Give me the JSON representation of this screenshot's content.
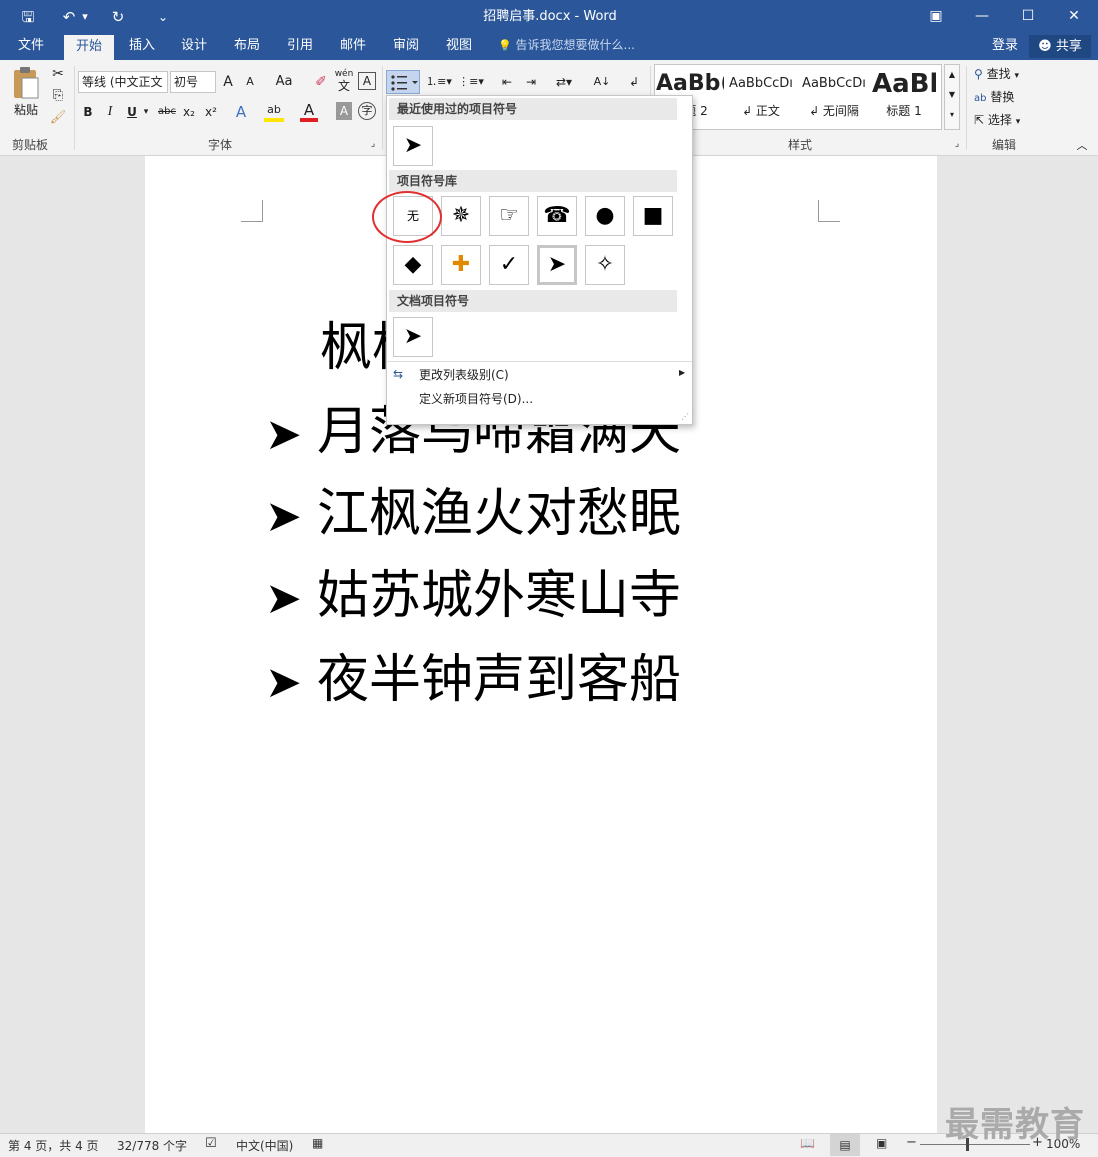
{
  "window": {
    "title": "招聘启事.docx - Word",
    "controls": {
      "ribbon_display": "▣",
      "minimize": "—",
      "maximize": "☐",
      "close": "✕"
    }
  },
  "quick_access": {
    "save": "🖫",
    "undo": "↶",
    "undo_menu": "▾",
    "redo": "↻",
    "customize": "⌄"
  },
  "tabs": [
    "文件",
    "开始",
    "插入",
    "设计",
    "布局",
    "引用",
    "邮件",
    "审阅",
    "视图"
  ],
  "active_tab": "开始",
  "tell_me": {
    "icon": "💡",
    "placeholder": "告诉我您想要做什么..."
  },
  "account": {
    "login": "登录",
    "share": "共享"
  },
  "ribbon": {
    "clipboard": {
      "paste": "粘贴",
      "label": "剪贴板"
    },
    "font": {
      "name": "等线 (中文正文",
      "size": "初号",
      "grow": "A",
      "shrink": "A",
      "case": "Aa",
      "clear": "✐",
      "pinyin_top": "wén",
      "pinyin_bottom": "文",
      "border": "A",
      "bold": "B",
      "italic": "I",
      "underline": "U",
      "strike": "abc",
      "sub": "x₂",
      "sup": "x²",
      "effects": "A",
      "highlight": "ab",
      "font_color": "A",
      "shading": "A",
      "label": "字体"
    },
    "paragraph": {
      "sort": "A↓",
      "marks": "↲"
    },
    "styles": {
      "items": [
        {
          "preview": "AaBb(",
          "name": "标题 2"
        },
        {
          "preview": "AaBbCcDı",
          "name": "↲ 正文"
        },
        {
          "preview": "AaBbCcDı",
          "name": "↲ 无间隔"
        },
        {
          "preview": "AaBl",
          "name": "标题 1"
        }
      ],
      "label": "样式"
    },
    "editing": {
      "find": "查找",
      "replace": "替换",
      "select": "选择",
      "label": "编辑"
    }
  },
  "bullet_dropdown": {
    "recent_header": "最近使用过的项目符号",
    "recent": [
      "➤"
    ],
    "library_header": "项目符号库",
    "library": [
      "无",
      "✵",
      "☞",
      "☎",
      "●",
      "■",
      "◆",
      "✚",
      "✓",
      "➤",
      "✧"
    ],
    "selected_index": 9,
    "document_header": "文档项目符号",
    "document": [
      "➤"
    ],
    "change_level": "更改列表级别(C)",
    "define_new": "定义新项目符号(D)..."
  },
  "document": {
    "title_partial": "枫桥",
    "lines": [
      {
        "bullet": "➤",
        "text": "月落乌啼霜满天"
      },
      {
        "bullet": "➤",
        "text": "江枫渔火对愁眠"
      },
      {
        "bullet": "➤",
        "text": "姑苏城外寒山寺"
      },
      {
        "bullet": "➤",
        "text": "夜半钟声到客船"
      }
    ]
  },
  "status": {
    "page": "第 4 页，共 4 页",
    "words": "32/778 个字",
    "language": "中文(中国)",
    "zoom": "100%"
  },
  "watermark": "最需教育",
  "colors": {
    "accent": "#2b579a",
    "annotation_circle": "#e03030"
  }
}
